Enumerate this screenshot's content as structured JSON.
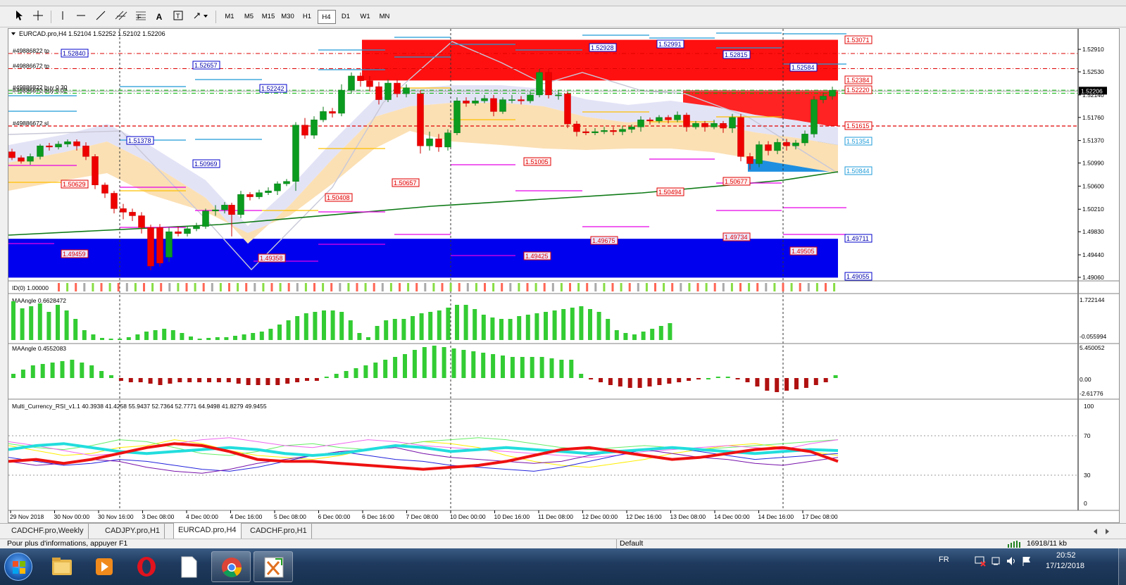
{
  "toolbar": {
    "timeframes": [
      "M1",
      "M5",
      "M15",
      "M30",
      "H1",
      "H4",
      "D1",
      "W1",
      "MN"
    ],
    "active_timeframe": "H4"
  },
  "chart": {
    "header": "EURCAD.pro,H4  1.52104 1.52252 1.52102 1.52206",
    "current_price": "1.52206",
    "price_axis": [
      "1.52910",
      "1.52530",
      "1.52140",
      "1.51760",
      "1.51370",
      "1.50990",
      "1.50600",
      "1.50210",
      "1.49830",
      "1.49440",
      "1.49060"
    ],
    "time_axis": [
      "29 Nov 2018",
      "30 Nov 00:00",
      "30 Nov 16:00",
      "3 Dec 08:00",
      "4 Dec 00:00",
      "4 Dec 16:00",
      "5 Dec 08:00",
      "6 Dec 00:00",
      "6 Dec 16:00",
      "7 Dec 08:00",
      "10 Dec 00:00",
      "10 Dec 16:00",
      "11 Dec 08:00",
      "12 Dec 00:00",
      "12 Dec 16:00",
      "13 Dec 08:00",
      "14 Dec 00:00",
      "14 Dec 16:00",
      "17 Dec 08:00"
    ],
    "order_lines": [
      {
        "label": "#49886822 tp",
        "color": "#dd0000"
      },
      {
        "label": "#49886672 tp",
        "color": "#dd0000"
      },
      {
        "label": "#49886822 buy 0.30",
        "color": "#00a000"
      },
      {
        "label": "#49886672 buy 0.02",
        "color": "#00a000"
      },
      {
        "label": "#49886672 sl",
        "color": "#dd0000"
      }
    ],
    "level_tags_blue": [
      "1.52840",
      "1.52657",
      "1.52242",
      "1.51378",
      "1.50969",
      "1.52928",
      "1.52991",
      "1.52815",
      "1.52584"
    ],
    "level_tags_red": [
      "1.50629",
      "1.49459",
      "1.50408",
      "1.50657",
      "1.49358",
      "1.51005",
      "1.49425",
      "1.49675",
      "1.50494",
      "1.50677",
      "1.49734",
      "1.49505"
    ],
    "right_tags": [
      {
        "value": "1.53071",
        "type": "red"
      },
      {
        "value": "1.52384",
        "type": "red"
      },
      {
        "value": "1.52220",
        "type": "red"
      },
      {
        "value": "1.51615",
        "type": "red"
      },
      {
        "value": "1.51354",
        "type": "lightblue"
      },
      {
        "value": "1.50844",
        "type": "lightblue"
      },
      {
        "value": "1.49711",
        "type": "blue"
      },
      {
        "value": "1.49055",
        "type": "blue"
      }
    ]
  },
  "indicators": {
    "id_label": "ID(0) 1.00000",
    "ma1_label": "MAAngle 0.6628472",
    "ma1_axis": [
      "1.722144",
      "-0.055994"
    ],
    "ma2_label": "MAAngle 0.4552083",
    "ma2_axis": [
      "5.450052",
      "0.00",
      "-2.61776"
    ],
    "rsi_label": "Multi_Currency_RSI_v1.1 40.3938 41.4258 55.9437 52.7364 52.7771 64.9498 41.8279 49.9455",
    "rsi_axis": [
      "100",
      "70",
      "30",
      "0"
    ]
  },
  "tabs": [
    "CADCHF.pro,Weekly",
    "CADJPY.pro,H1",
    "EURCAD.pro,H4",
    "CADCHF.pro,H1"
  ],
  "active_tab": "EURCAD.pro,H4",
  "status": {
    "help": "Pour plus d'informations, appuyer F1",
    "profile": "Default",
    "traffic": "16918/11 kb"
  },
  "taskbar": {
    "lang": "FR",
    "time": "20:52",
    "date": "17/12/2018"
  },
  "colors": {
    "bull": "#0a9b1f",
    "bear": "#ee0000",
    "red_zone": "#ff1010",
    "blue_zone": "#0000ee"
  }
}
